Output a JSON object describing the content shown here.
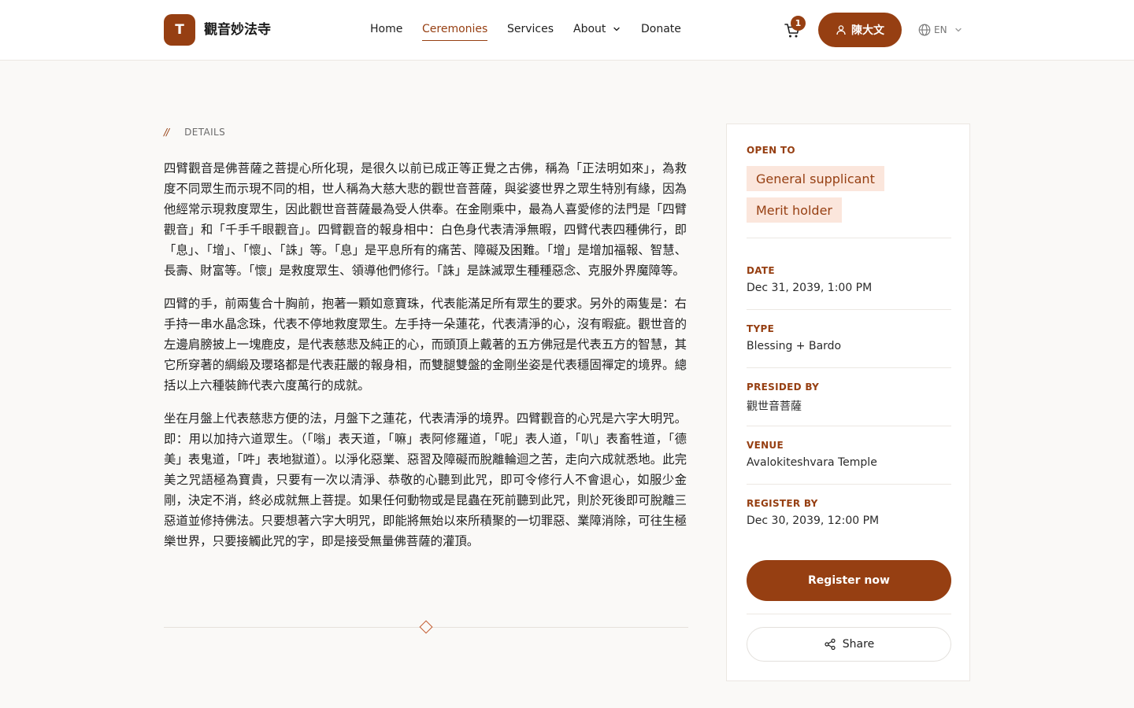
{
  "header": {
    "logo_letter": "T",
    "site_name": "觀音妙法寺",
    "nav": [
      {
        "label": "Home"
      },
      {
        "label": "Ceremonies",
        "active": true
      },
      {
        "label": "Services"
      },
      {
        "label": "About",
        "has_dropdown": true
      },
      {
        "label": "Donate"
      }
    ],
    "cart_count": "1",
    "user_name": "陳大文",
    "language": "EN"
  },
  "details": {
    "label": "DETAILS",
    "paragraphs": [
      "四臂觀音是佛菩薩之菩提心所化現，是很久以前已成正等正覺之古佛，稱為「正法明如來」，為救度不同眾生而示現不同的相，世人稱為大慈大悲的觀世音菩薩，與娑婆世界之眾生特別有緣，因為他經常示現救度眾生，因此觀世音菩薩最為受人供奉。在金剛乘中，最為人喜愛修的法門是「四臂觀音」和「千手千眼觀音」。四臂觀音的報身相中：白色身代表清淨無暇，四臂代表四種佛行，即「息」、「增」、「懷」、「誅」等。「息」是平息所有的痛苦、障礙及困難。「增」是增加福報、智慧、長壽、財富等。「懷」是救度眾生、領導他們修行。「誅」是誅滅眾生種種惡念、克服外界魔障等。",
      "四臂的手，前兩隻合十胸前，抱著一顆如意寶珠，代表能滿足所有眾生的要求。另外的兩隻是：右手持一串水晶念珠，代表不停地救度眾生。左手持一朵蓮花，代表清淨的心，沒有暇疵。觀世音的左邊肩膀披上一塊鹿皮，是代表慈悲及純正的心，而頭頂上戴著的五方佛冠是代表五方的智慧，其它所穿著的綢緞及瓔珞都是代表莊嚴的報身相，而雙腿雙盤的金剛坐姿是代表穩固禪定的境界。總括以上六種裝飾代表六度萬行的成就。",
      "坐在月盤上代表慈悲方便的法，月盤下之蓮花，代表清淨的境界。四臂觀音的心咒是六字大明咒。即：用以加持六道眾生。（「嗡」表天道，「嘛」表阿修羅道，「呢」表人道，「叭」表畜牲道，「德美」表鬼道，「吽」表地獄道）。以淨化惡業、惡習及障礙而脫離輪迴之苦，走向六成就悉地。此完美之咒語極為寶貴，只要有一次以清淨、恭敬的心聽到此咒，即可令修行人不會退心，如服少金剛，決定不消，終必成就無上菩提。如果任何動物或是昆蟲在死前聽到此咒，則於死後即可脫離三惡道並修持佛法。只要想著六字大明咒，即能將無始以來所積聚的一切罪惡、業障消除，可往生極樂世界，只要接觸此咒的字，即是接受無量佛菩薩的灌頂。"
    ]
  },
  "sidebar": {
    "open_to_label": "OPEN TO",
    "open_to": [
      "General supplicant",
      "Merit holder"
    ],
    "date_label": "DATE",
    "date": "Dec 31, 2039, 1:00 PM",
    "type_label": "TYPE",
    "type": "Blessing + Bardo",
    "presided_label": "PRESIDED BY",
    "presided": "觀世音菩薩",
    "venue_label": "VENUE",
    "venue": "Avalokiteshvara Temple",
    "register_by_label": "REGISTER BY",
    "register_by": "Dec 30, 2039, 12:00 PM",
    "register_button": "Register now",
    "share_button": "Share"
  },
  "colors": {
    "accent": "#963f12",
    "tag_bg": "#fbe6dc",
    "background": "#faf9f7"
  },
  "icons": [
    "cart-icon",
    "user-icon",
    "globe-icon",
    "chevron-down-icon",
    "share-icon",
    "diamond-ornament-icon"
  ]
}
